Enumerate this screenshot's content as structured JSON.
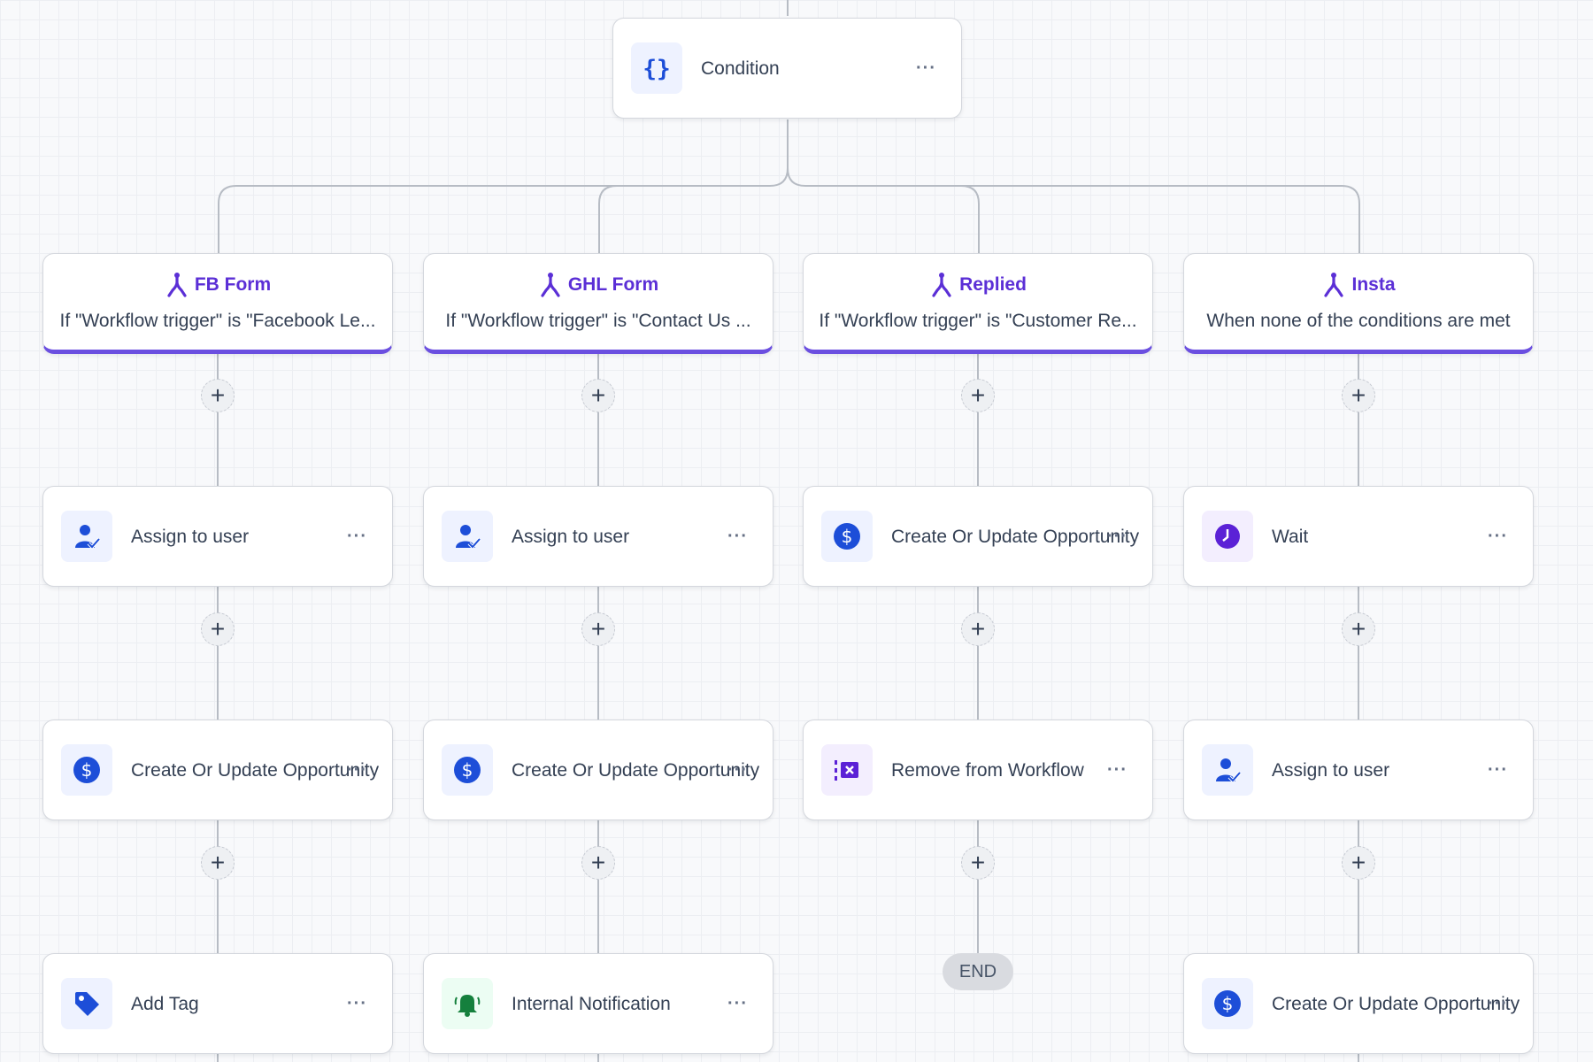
{
  "condition": {
    "label": "Condition",
    "more": "···",
    "icon": "curly-braces-icon"
  },
  "branches": [
    {
      "title": "FB Form",
      "desc": "If \"Workflow trigger\" is \"Facebook Le...",
      "icon": "branch-icon"
    },
    {
      "title": "GHL Form",
      "desc": "If \"Workflow trigger\" is \"Contact Us ...",
      "icon": "branch-icon"
    },
    {
      "title": "Replied",
      "desc": "If \"Workflow trigger\" is \"Customer Re...",
      "icon": "branch-icon"
    },
    {
      "title": "Insta",
      "desc": "When none of the conditions are met",
      "icon": "branch-icon"
    }
  ],
  "columns": [
    {
      "steps": [
        {
          "label": "Assign to user",
          "icon": "assign-user-icon"
        },
        {
          "label": "Create Or Update Opportunity",
          "icon": "dollar-icon"
        },
        {
          "label": "Add Tag",
          "icon": "tag-icon"
        }
      ]
    },
    {
      "steps": [
        {
          "label": "Assign to user",
          "icon": "assign-user-icon"
        },
        {
          "label": "Create Or Update Opportunity",
          "icon": "dollar-icon"
        },
        {
          "label": "Internal Notification",
          "icon": "bell-icon"
        }
      ]
    },
    {
      "steps": [
        {
          "label": "Create Or Update Opportunity",
          "icon": "dollar-icon"
        },
        {
          "label": "Remove from Workflow",
          "icon": "remove-workflow-icon"
        }
      ],
      "end_label": "END"
    },
    {
      "steps": [
        {
          "label": "Wait",
          "icon": "clock-icon"
        },
        {
          "label": "Assign to user",
          "icon": "assign-user-icon"
        },
        {
          "label": "Create Or Update Opportunity",
          "icon": "dollar-icon"
        }
      ]
    }
  ],
  "more_label": "···",
  "plus_label": "+",
  "colors": {
    "accent": "#6b4fe0",
    "branch_text": "#5b2fd6",
    "icon_blue": "#1d4ed8",
    "icon_purple": "#5b21d6",
    "icon_green": "#15803d"
  }
}
